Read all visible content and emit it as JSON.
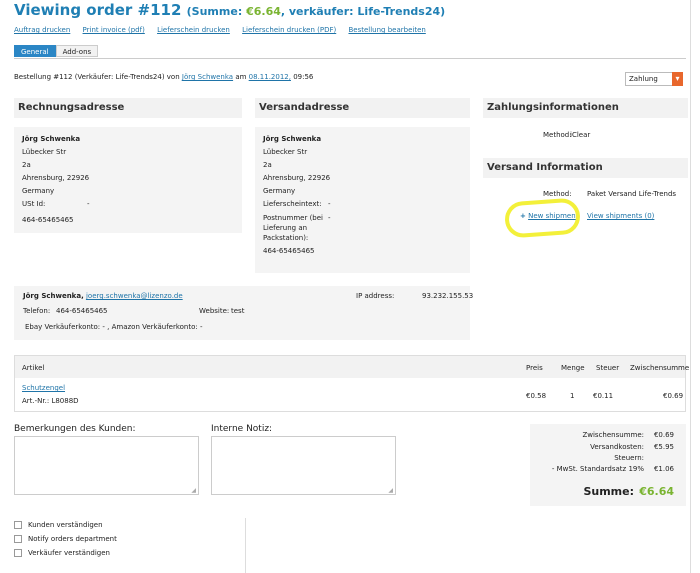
{
  "header": {
    "title": "Viewing order #112",
    "sum_prefix": "(Summe:",
    "sum_amount": "€6.64",
    "sum_suffix": ", verkäufer: Life-Trends24)"
  },
  "links": [
    "Auftrag drucken",
    "Print invoice (pdf)",
    "Lieferschein drucken",
    "Lieferschein drucken (PDF)",
    "Bestellung bearbeiten"
  ],
  "tabs": [
    "General",
    "Add-ons"
  ],
  "order_line": {
    "prefix": "Bestellung  #112 (Verkäufer: Life-Trends24) von",
    "customer": "Jörg Schwenka",
    "am": "am",
    "date": "08.11.2012,",
    "time": "09:56"
  },
  "payment_select": "Zahlung",
  "rechnung": {
    "heading": "Rechnungsadresse",
    "name": "Jörg Schwenka",
    "street": "Lübecker Str",
    "number": "2a",
    "city": "Ahrensburg, 22926",
    "country": "Germany",
    "ust_label": "USt Id:",
    "ust_value": "-",
    "phone": "464-65465465"
  },
  "versand": {
    "heading": "Versandadresse",
    "name": "Jörg Schwenka",
    "street": "Lübecker Str",
    "number": "2a",
    "city": "Ahrensburg, 22926",
    "country": "Germany",
    "lieferschein_label": "Lieferscheintext:",
    "lieferschein_value": "-",
    "postnummer_label": "Postnummer (bei Lieferung an Packstation):",
    "postnummer_value": "-",
    "phone": "464-65465465"
  },
  "zahlung": {
    "heading": "Zahlungsinformationen",
    "method_label": "Method:",
    "method_value": "iClear"
  },
  "versand_info": {
    "heading": "Versand Information",
    "method_label": "Method:",
    "method_value": "Paket Versand Life-Trends",
    "new_shipment": "New shipment",
    "view_shipments": "View shipments (0)"
  },
  "customer": {
    "name": "Jörg Schwenka,",
    "email": "joerg.schwenka@lizenzo.de",
    "ip_label": "IP address:",
    "ip_value": "93.232.155.53",
    "phone_label": "Telefon:",
    "phone_value": "464-65465465",
    "website_label": "Website:",
    "website_value": "test",
    "konto_line": "Ebay Verkäuferkonto: - ,  Amazon Verkäuferkonto: -"
  },
  "articles": {
    "headers": [
      "Artikel",
      "Preis",
      "Menge",
      "Steuer",
      "Zwischensumme"
    ],
    "rows": [
      {
        "name": "Schutzengel",
        "artnr": "Art.-Nr.: L8088D",
        "preis": "€0.58",
        "menge": "1",
        "steuer": "€0.11",
        "zwischensumme": "€0.69"
      }
    ]
  },
  "notes": {
    "kunden_label": "Bemerkungen des Kunden:",
    "intern_label": "Interne Notiz:"
  },
  "totals": {
    "zwischensumme_label": "Zwischensumme:",
    "zwischensumme": "€0.69",
    "versandkosten_label": "Versandkosten:",
    "versandkosten": "€5.95",
    "steuern_label": "Steuern:",
    "mwst_label": "- MwSt. Standardsatz 19%",
    "mwst": "€1.06",
    "summe_label": "Summe:",
    "summe": "€6.64"
  },
  "checkboxes": [
    "Kunden verständigen",
    "Notify orders department",
    "Verkäufer verständigen"
  ],
  "colors": {
    "accent": "#1f7fb4",
    "green": "#7ab431",
    "highlight": "#f3f03a",
    "orange": "#e8672c"
  }
}
